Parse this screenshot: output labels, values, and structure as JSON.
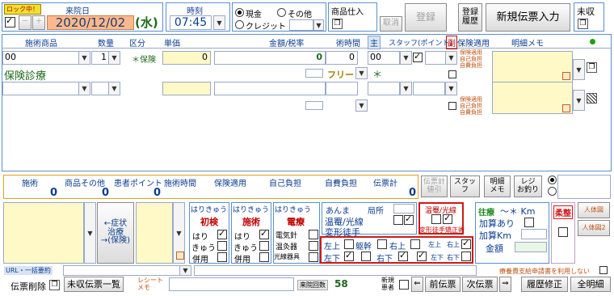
{
  "top": {
    "lock_label": "ロック中！",
    "date_label": "来院日",
    "prev_label": "－",
    "next_label": "＋",
    "date_value": "2020/12/02",
    "weekday": "(水)",
    "time_label": "時刻",
    "time_value": "07:45",
    "pay_cash": "現金",
    "pay_other": "その他",
    "pay_credit": "クレジット",
    "goods_label": "商品仕入",
    "cancel_label": "取消",
    "register_label": "登録",
    "history_label": "登録\n履歴",
    "new_slip_label": "新規伝票入力",
    "unpaid_label": "未収"
  },
  "table": {
    "headers": [
      "施術商品",
      "数量",
      "区分",
      "単価",
      "金額/税率",
      "術時間",
      "主",
      "スタッフ(ポイント)",
      "副",
      "保険適用",
      "明細メモ"
    ],
    "rows": [
      {
        "code": "00",
        "qty": "1",
        "kubun": "＊保険",
        "price": "0",
        "amount": "0",
        "time_code": "00",
        "insurance": [
          "保険適用",
          "自己負担",
          "自費負担"
        ],
        "staff": ""
      },
      {
        "name": "保険診療",
        "free": "フリー",
        "mark": "＊"
      },
      {
        "insurance": [
          "保険適用",
          "自己負担",
          "自費負担"
        ]
      }
    ]
  },
  "totals": {
    "headers": [
      "施術",
      "商品その他",
      "患者ポイント",
      "施術時間",
      "保険適用",
      "自己負担",
      "自費負担",
      "伝票計"
    ],
    "values": [
      "0",
      "0",
      "0",
      "",
      "",
      "",
      "",
      "0"
    ],
    "slip_calc_label": "伝票計\n値引",
    "staff_label": "スタッフ",
    "detail_memo_label": "明細\nメモ",
    "receipt_label": "レジ\nお釣り"
  },
  "bottom": {
    "symptom_label": "←症状\n治療\n→(保険)",
    "hari_kyu": "はりきゅう",
    "col1_title": "初検",
    "col1_items": [
      "はり",
      "きゅう",
      "併用"
    ],
    "col2_title": "施術",
    "col2_items": [
      "はり",
      "きゅう",
      "併用"
    ],
    "col3_title": "電療",
    "col3_items": [
      "電気針",
      "温灸器",
      "光線器具"
    ],
    "anma": "あんま",
    "kyokusho": "局所",
    "onshitsu": "温罨/光線",
    "henkei": "変形徒手",
    "onshitsu2": "温罨/光線",
    "henkei2": "変形徒手矯正術",
    "body_items": [
      "左上",
      "躯幹",
      "右上",
      "左下",
      "右下"
    ],
    "body_small": [
      "左上",
      "右上",
      "左下",
      "右下"
    ],
    "ourai": "往療",
    "km": "～＊ Km",
    "kasan_ari": "加算あり",
    "kasan_km": "加算Km",
    "kingaku": "金額",
    "judo": "柔整",
    "jinkei": "人体図",
    "jinkei2": "人体図2",
    "url_label": "URL・一括要約",
    "shien_label": "療養費支給申請書を利用しない",
    "delete_label": "伝票削除",
    "unpaid_list": "未収伝票一覧",
    "receipt_memo": "レシート\nメモ",
    "visits_label": "来院回数",
    "visits_value": "58",
    "new_patient": "新規\n患者",
    "prev_slip": "前伝票",
    "next_slip": "次伝票",
    "history_fix": "履歴修正",
    "all_detail": "全明細"
  }
}
